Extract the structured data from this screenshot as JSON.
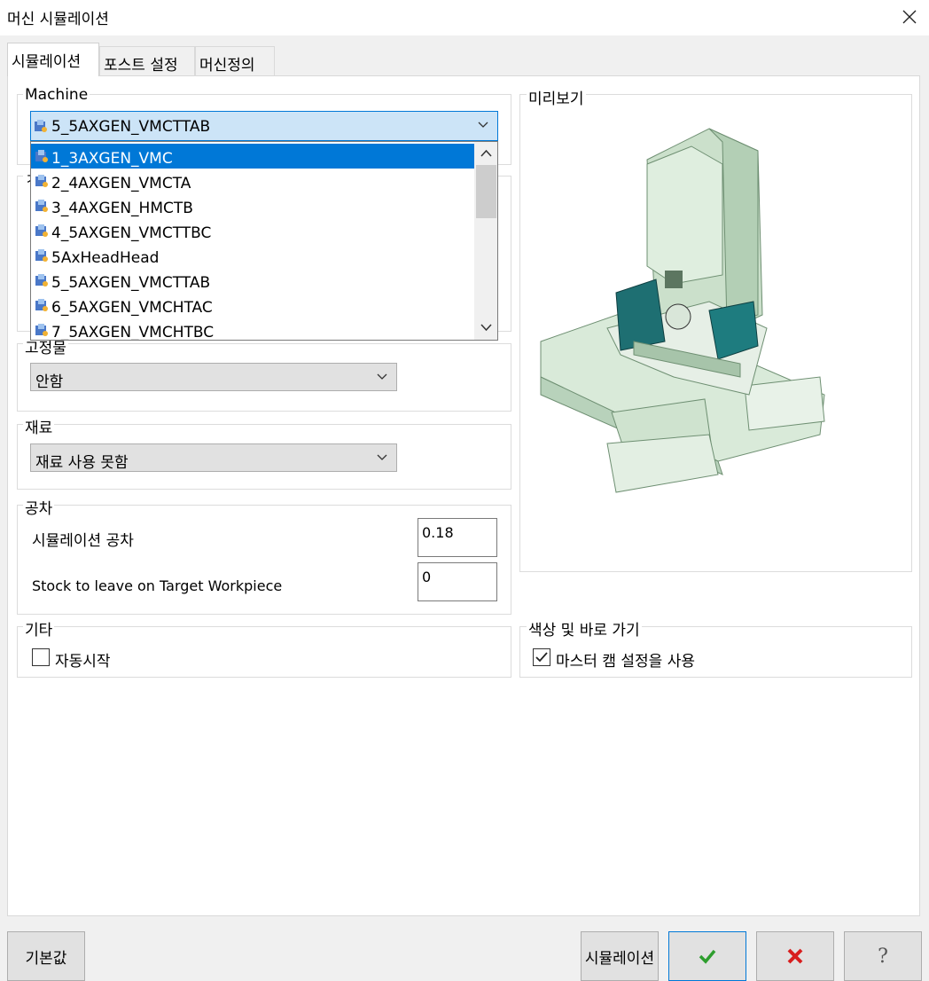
{
  "window": {
    "title": "머신 시뮬레이션"
  },
  "tabs": [
    {
      "label": "시뮬레이션",
      "active": true
    },
    {
      "label": "포스트 설정",
      "active": false
    },
    {
      "label": "머신정의",
      "active": false
    }
  ],
  "machine": {
    "legend": "Machine",
    "selected": "5_5AXGEN_VMCTTAB",
    "options": [
      "1_3AXGEN_VMC",
      "2_4AXGEN_VMCTA",
      "3_4AXGEN_HMCTB",
      "4_5AXGEN_VMCTTBC",
      "5AxHeadHead",
      "5_5AXGEN_VMCTTAB",
      "6_5AXGEN_VMCHTAC",
      "7_5AXGEN_VMCHTBC"
    ],
    "highlighted_index": 0
  },
  "hidden_group_legend_fragment": "ㅈ",
  "fixture": {
    "legend": "고정물",
    "selected": "안함"
  },
  "stock": {
    "legend": "재료",
    "selected": "재료 사용 못함"
  },
  "tolerance": {
    "legend": "공차",
    "sim_label": "시뮬레이션 공차",
    "sim_value": "0.18",
    "stock_label": "Stock to leave on Target Workpiece",
    "stock_value": "0"
  },
  "misc": {
    "legend": "기타",
    "autostart_label": "자동시작",
    "autostart_checked": false
  },
  "preview": {
    "legend": "미리보기"
  },
  "color": {
    "legend": "색상 및 바로 가기",
    "master_label": "마스터 캠 설정을 사용",
    "master_checked": true
  },
  "buttons": {
    "defaults": "기본값",
    "simulate": "시뮬레이션",
    "ok_icon": "check-icon",
    "cancel_icon": "x-icon",
    "help_icon": "question-icon"
  },
  "colors": {
    "accent": "#0078d7",
    "ok": "#2e9e2e",
    "cancel": "#d81e1e",
    "selection": "#cce4f7"
  }
}
